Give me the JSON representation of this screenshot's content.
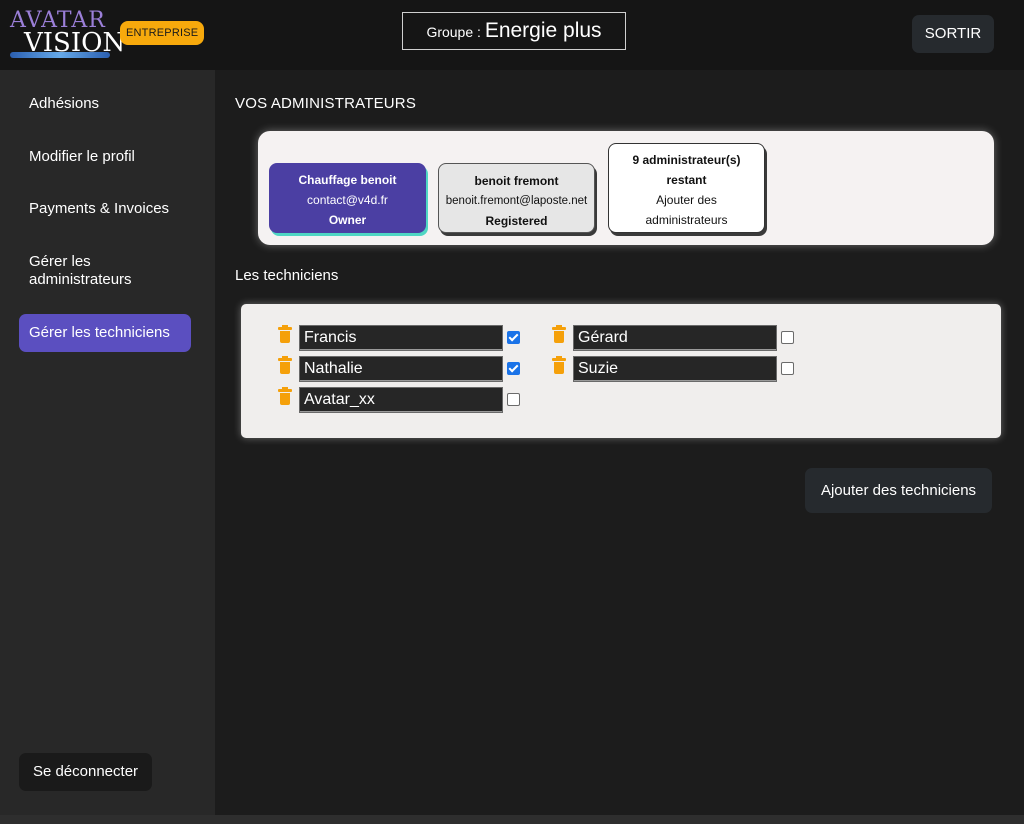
{
  "header": {
    "logo_line1": "AVATAR",
    "logo_line2": "VISION",
    "badge": "ENTREPRISE",
    "group_label": "Groupe : ",
    "group_name": "Energie plus",
    "exit_label": "SORTIR"
  },
  "sidebar": {
    "items": [
      {
        "label": "Adhésions"
      },
      {
        "label": "Modifier le profil"
      },
      {
        "label": "Payments & Invoices"
      },
      {
        "label": "Gérer les administrateurs"
      },
      {
        "label": "Gérer les techniciens"
      }
    ],
    "active_index": 4,
    "logout_label": "Se déconnecter"
  },
  "admins": {
    "title": "VOS ADMINISTRATEURS",
    "cards": [
      {
        "name": "Chauffage benoit",
        "email": "contact@v4d.fr",
        "role": "Owner"
      },
      {
        "name": "benoit fremont",
        "email": "benoit.fremont@laposte.net",
        "role": "Registered"
      }
    ],
    "remaining_line1": "9 administrateur(s)",
    "remaining_line2": "restant",
    "add_line1": "Ajouter des",
    "add_line2": "administrateurs"
  },
  "techniciens": {
    "title": "Les techniciens",
    "list": [
      {
        "name": "Francis",
        "checked": true
      },
      {
        "name": "Gérard",
        "checked": false
      },
      {
        "name": "Nathalie",
        "checked": true
      },
      {
        "name": "Suzie",
        "checked": false
      },
      {
        "name": "Avatar_xx",
        "checked": false
      }
    ],
    "add_label": "Ajouter des techniciens"
  },
  "colors": {
    "accent": "#5b4fc0",
    "badge": "#f7a90c",
    "trash": "#f5a00a",
    "checkbox": "#1a73e8"
  }
}
